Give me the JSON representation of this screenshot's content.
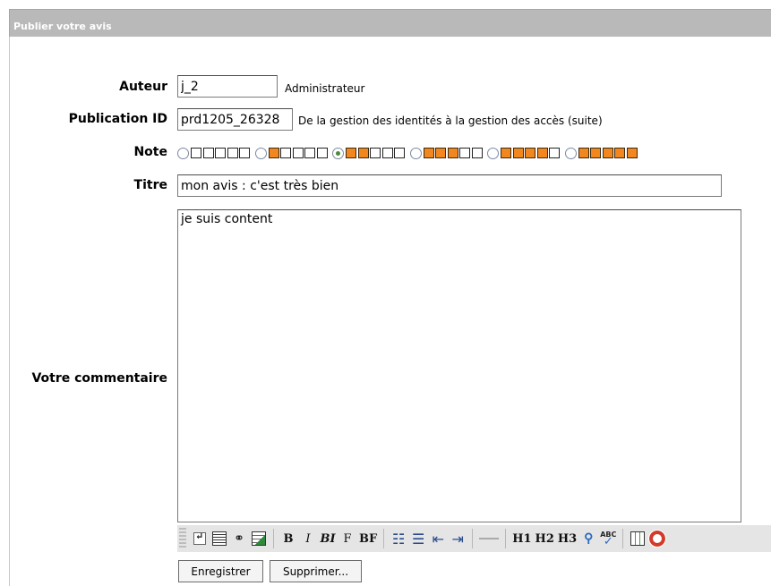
{
  "header": {
    "title": "Publier votre avis"
  },
  "form": {
    "author": {
      "label": "Auteur",
      "value": "j_2",
      "role": "Administrateur"
    },
    "publication": {
      "label": "Publication ID",
      "value": "prd1205_26328",
      "title": "De la gestion des identités à la gestion des accès (suite)"
    },
    "note": {
      "label": "Note",
      "selected": 2,
      "options": [
        0,
        1,
        2,
        3,
        4,
        5
      ],
      "max": 5
    },
    "titre": {
      "label": "Titre",
      "value": "mon avis : c'est très bien"
    },
    "comment": {
      "label": "Votre commentaire",
      "value": "je suis content"
    }
  },
  "toolbar": {
    "bold": "B",
    "italic": "I",
    "bold_italic": "BI",
    "font": "F",
    "bold_font": "BF",
    "h1": "H1",
    "h2": "H2",
    "h3": "H3"
  },
  "buttons": {
    "save": "Enregistrer",
    "delete": "Supprimer..."
  },
  "colors": {
    "header_bg": "#b9b9b9",
    "star_on": "#f2871f"
  }
}
